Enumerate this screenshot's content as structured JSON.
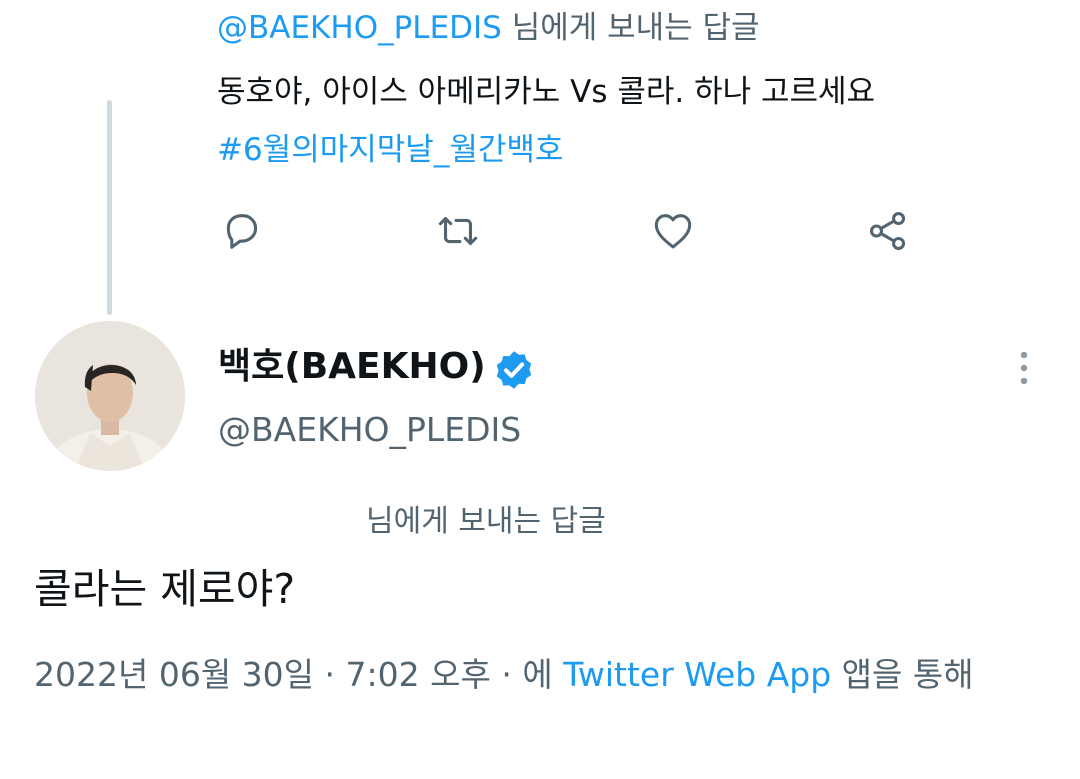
{
  "parent_tweet": {
    "replying_mention": "@BAEKHO_PLEDIS",
    "replying_suffix": " 님에게 보내는 답글",
    "text": "동호야, 아이스 아메리카노 Vs 콜라. 하나 고르세요",
    "hashtag": "#6월의마지막날_월간백호",
    "actions": {
      "reply_icon": "reply-icon",
      "retweet_icon": "retweet-icon",
      "like_icon": "heart-icon",
      "share_icon": "share-icon"
    }
  },
  "reply_tweet": {
    "display_name": "백호(BAEKHO)",
    "handle": "@BAEKHO_PLEDIS",
    "verified": true,
    "replying_label": "님에게 보내는 답글",
    "text": "콜라는 제로야?",
    "date": "2022년 06월 30일",
    "separator": " · ",
    "time": "7:02 오후",
    "via_prefix": "에 ",
    "source": "Twitter Web App",
    "via_suffix": " 앱을 통해"
  },
  "colors": {
    "accent": "#1d9bf0",
    "text_primary": "#0f1419",
    "text_secondary": "#536471",
    "thread_line": "#cfd9de"
  }
}
